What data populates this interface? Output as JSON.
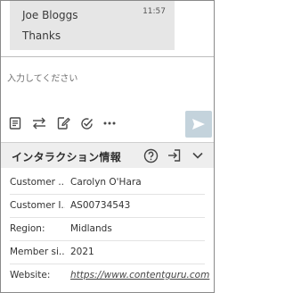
{
  "chat": {
    "sender": "Joe Bloggs",
    "time": "11:57",
    "message": "Thanks"
  },
  "input": {
    "placeholder": "入力してください"
  },
  "toolbar": {
    "icons": [
      "document-icon",
      "transfer-icon",
      "edit-note-icon",
      "check-circle-icon",
      "more-icon",
      "send-icon"
    ]
  },
  "panel": {
    "title": "インタラクション情報",
    "rows": [
      {
        "label": "Customer ...",
        "value": "Carolyn O'Hara"
      },
      {
        "label": "Customer I...",
        "value": "AS00734543"
      },
      {
        "label": "Region:",
        "value": "Midlands"
      },
      {
        "label": "Member si...",
        "value": "2021"
      },
      {
        "label": "Website:",
        "value": "https://www.contentguru.com"
      }
    ]
  },
  "colors": {
    "bubble": "#e6e6e6",
    "send_button": "#c4d3dc",
    "panel_header": "#eeeeee",
    "icon": "#4a4a4a"
  }
}
